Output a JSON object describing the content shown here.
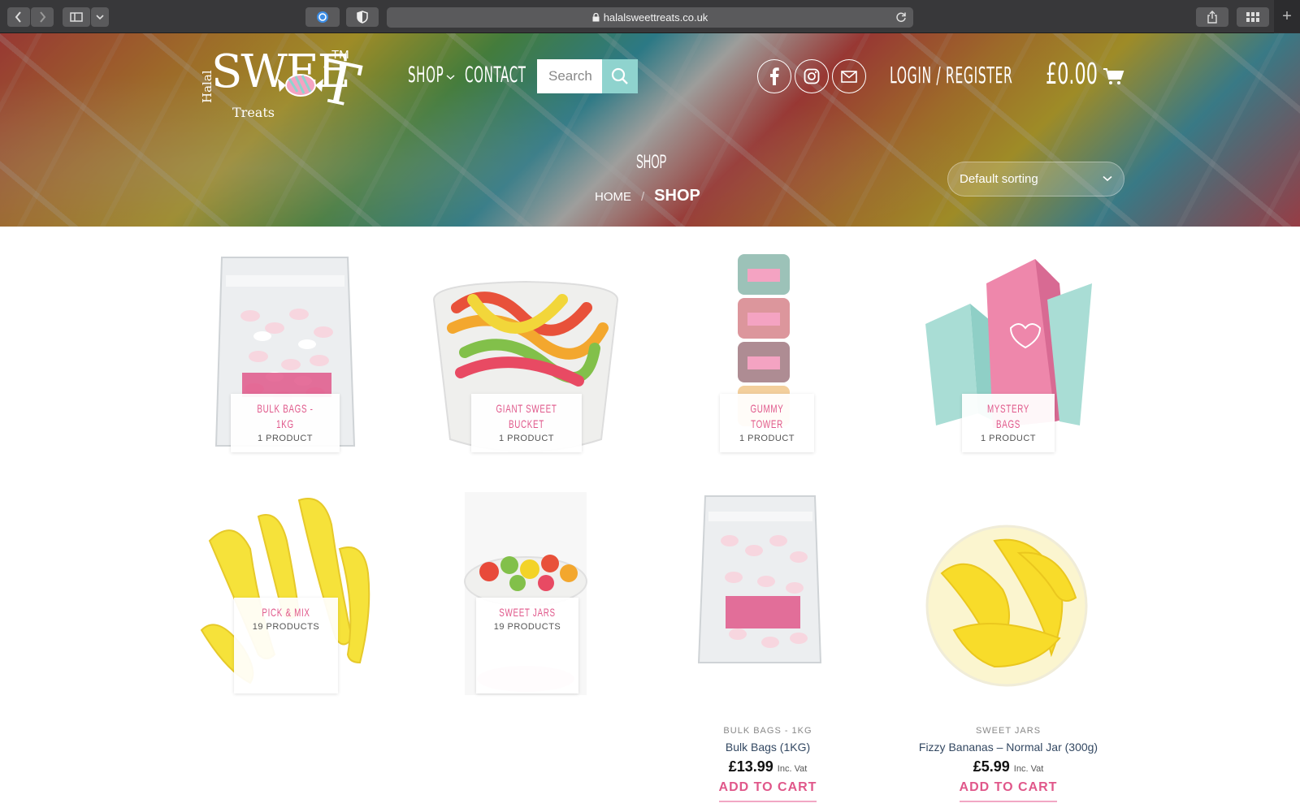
{
  "browser": {
    "url": "halalsweettreats.co.uk",
    "new_tab_symbol": "+"
  },
  "header": {
    "logo": {
      "halal": "Halal",
      "sweet": "SWEE",
      "t": "T",
      "treats": "Treats",
      "tm": "TM"
    },
    "nav": {
      "shop": "SHOP",
      "contact": "CONTACT"
    },
    "search": {
      "placeholder": "Search"
    },
    "account": "LOGIN / REGISTER",
    "cart_total": "£0.00"
  },
  "page": {
    "title": "SHOP",
    "breadcrumb": {
      "home": "HOME",
      "separator": "/",
      "current": "SHOP"
    },
    "sorting": "Default sorting"
  },
  "categories": [
    {
      "name": "BULK BAGS - 1KG",
      "count": "1 PRODUCT"
    },
    {
      "name": "GIANT SWEET BUCKET",
      "count": "1 PRODUCT"
    },
    {
      "name": "GUMMY TOWER",
      "count": "1 PRODUCT"
    },
    {
      "name": "MYSTERY BAGS",
      "count": "1 PRODUCT"
    },
    {
      "name": "PICK & MIX",
      "count": "19 PRODUCTS"
    },
    {
      "name": "SWEET JARS",
      "count": "19 PRODUCTS"
    }
  ],
  "products": [
    {
      "category": "BULK BAGS - 1KG",
      "title": "Bulk Bags (1KG)",
      "price": "£13.99",
      "vat": "Inc. Vat",
      "button": "ADD TO CART"
    },
    {
      "category": "SWEET JARS",
      "title": "Fizzy Bananas – Normal Jar (300g)",
      "price": "£5.99",
      "vat": "Inc. Vat",
      "button": "ADD TO CART"
    }
  ],
  "colors": {
    "accent_pink": "#e0578a",
    "search_teal": "#8fd3ce",
    "title_navy": "#334862"
  }
}
